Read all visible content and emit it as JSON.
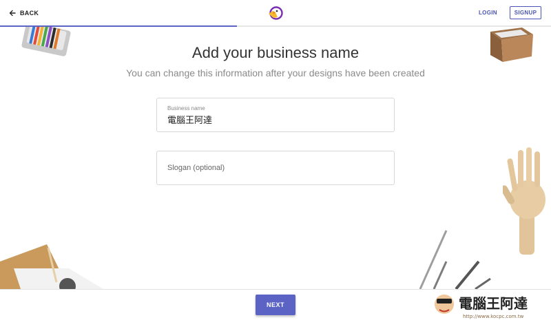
{
  "header": {
    "back_label": "BACK",
    "login_label": "LOGIN",
    "signup_label": "SIGNUP",
    "progress_fraction": 0.43
  },
  "main": {
    "title": "Add your business name",
    "subtitle": "You can change this information after your designs have been created",
    "business_field": {
      "label": "Business name",
      "value": "電腦王阿達"
    },
    "slogan_field": {
      "placeholder": "Slogan (optional)"
    }
  },
  "footer": {
    "next_label": "NEXT"
  },
  "watermark": {
    "brand": "電腦王阿達",
    "url": "http://www.kocpc.com.tw"
  },
  "colors": {
    "accent": "#5b63c4"
  },
  "icons": [
    "back-arrow-icon",
    "brand-logo",
    "pencil-case-decoration",
    "wooden-box-decoration",
    "wooden-hand-decoration",
    "pencils-decoration",
    "paper-decoration"
  ]
}
